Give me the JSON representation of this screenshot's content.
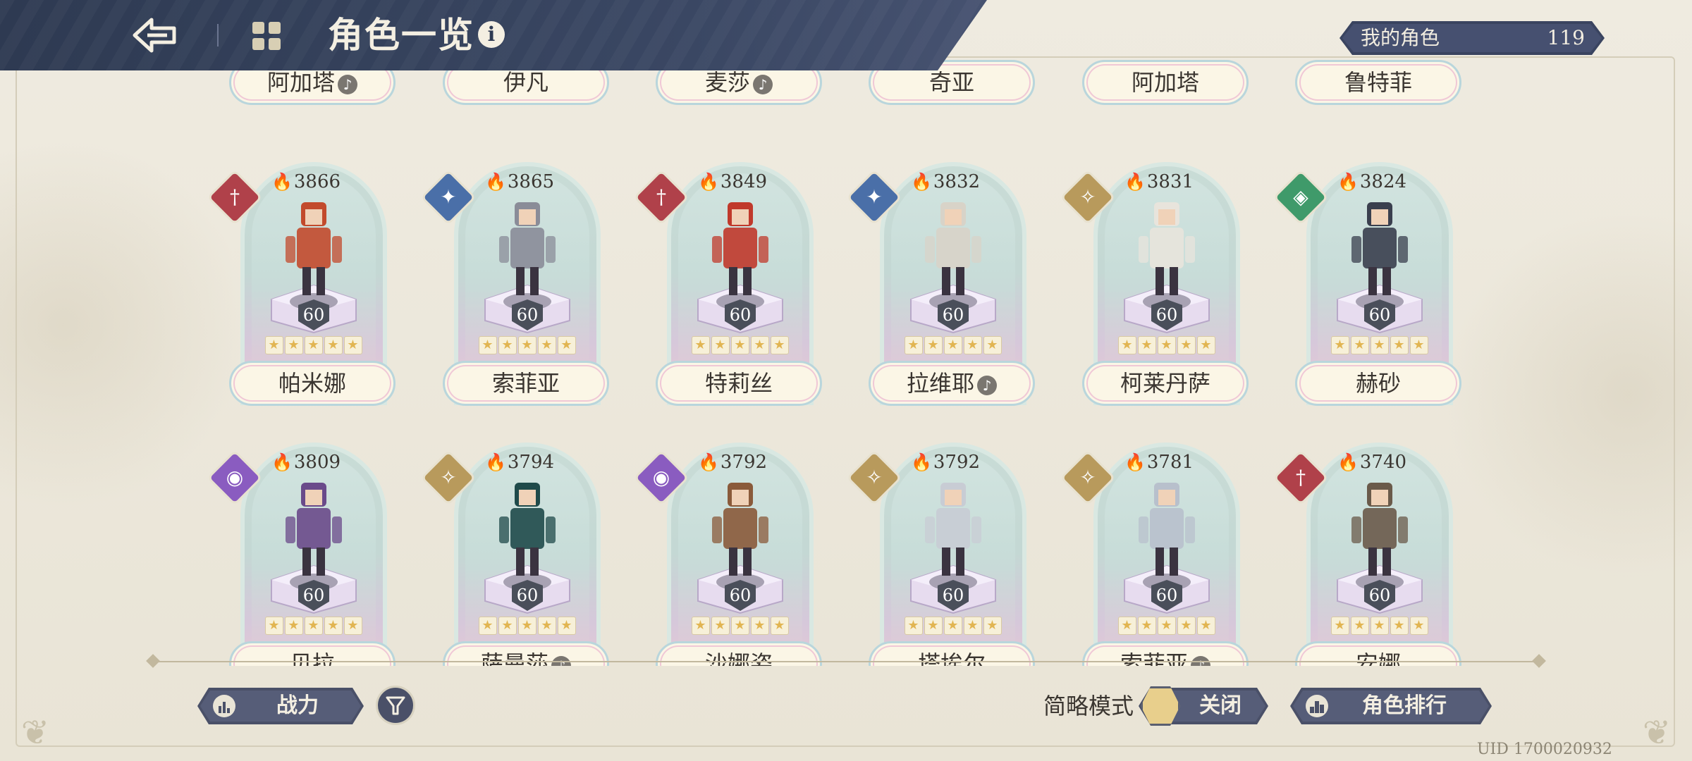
{
  "header": {
    "title": "角色一览",
    "info_label": "i"
  },
  "my_characters": {
    "label": "我的角色",
    "count": "119"
  },
  "top_row": [
    {
      "name": "阿加塔",
      "mark": true
    },
    {
      "name": "伊凡",
      "mark": false
    },
    {
      "name": "麦莎",
      "mark": true
    },
    {
      "name": "奇亚",
      "mark": false
    },
    {
      "name": "阿加塔",
      "mark": false
    },
    {
      "name": "鲁特菲",
      "mark": false
    }
  ],
  "rows": [
    [
      {
        "name": "帕米娜",
        "power": "3866",
        "level": "60",
        "element": "red-sword",
        "mark": false
      },
      {
        "name": "索菲亚",
        "power": "3865",
        "level": "60",
        "element": "blue-star",
        "mark": false
      },
      {
        "name": "特莉丝",
        "power": "3849",
        "level": "60",
        "element": "red-sword",
        "mark": false
      },
      {
        "name": "拉维耶",
        "power": "3832",
        "level": "60",
        "element": "blue-star",
        "mark": true
      },
      {
        "name": "柯莱丹萨",
        "power": "3831",
        "level": "60",
        "element": "gold-compass",
        "mark": false
      },
      {
        "name": "赫砂",
        "power": "3824",
        "level": "60",
        "element": "green-shield",
        "mark": false
      }
    ],
    [
      {
        "name": "贝拉",
        "power": "3809",
        "level": "60",
        "element": "purple-eye",
        "mark": false
      },
      {
        "name": "萨曼莎",
        "power": "3794",
        "level": "60",
        "element": "gold-compass",
        "mark": true
      },
      {
        "name": "沙娜姿",
        "power": "3792",
        "level": "60",
        "element": "purple-eye",
        "mark": false
      },
      {
        "name": "塔埃尔",
        "power": "3792",
        "level": "60",
        "element": "gold-compass",
        "mark": false
      },
      {
        "name": "索菲亚",
        "power": "3781",
        "level": "60",
        "element": "gold-compass",
        "mark": true
      },
      {
        "name": "安娜",
        "power": "3740",
        "level": "60",
        "element": "red-sword",
        "mark": false
      }
    ]
  ],
  "element_colors": {
    "red-sword": "#b0414a",
    "blue-star": "#4a6fa8",
    "gold-compass": "#b89a5c",
    "green-shield": "#3f9a6a",
    "purple-eye": "#8a5cc0"
  },
  "bottom_bar": {
    "sort_label": "战力",
    "simple_mode_label": "简略模式",
    "toggle_label": "关闭",
    "ranking_label": "角色排行",
    "uid": "UID 1700020932"
  }
}
